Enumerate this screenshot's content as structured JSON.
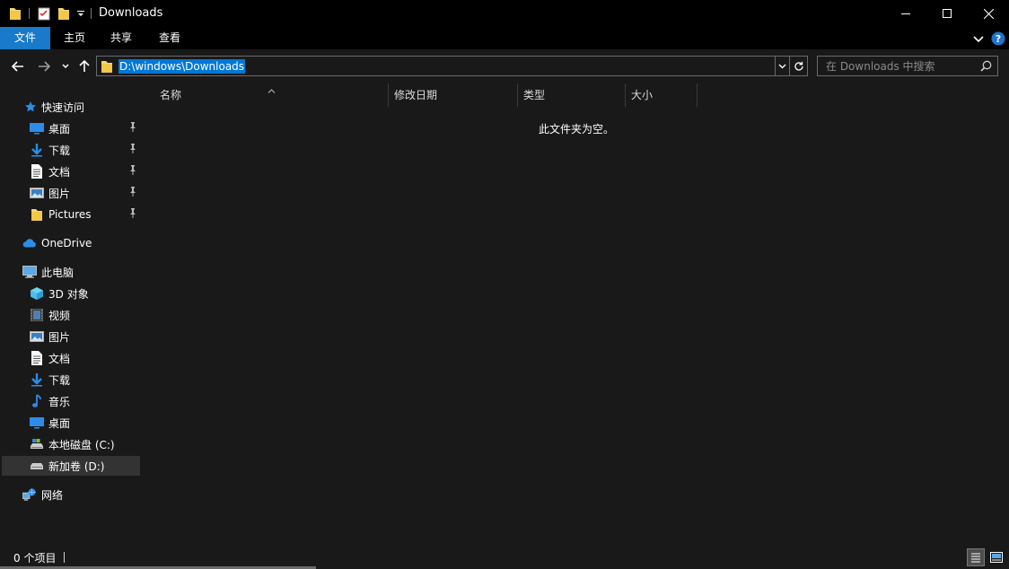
{
  "window": {
    "title": "Downloads",
    "minimize_glyph": "—",
    "maximize_glyph": "☐",
    "close_glyph": "✕"
  },
  "ribbon": {
    "tabs": [
      {
        "label": "文件",
        "active": true
      },
      {
        "label": "主页",
        "active": false
      },
      {
        "label": "共享",
        "active": false
      },
      {
        "label": "查看",
        "active": false
      }
    ]
  },
  "address": {
    "path": "D:\\windows\\Downloads"
  },
  "search": {
    "placeholder": "在 Downloads 中搜索"
  },
  "sidebar": {
    "quick_access": {
      "label": "快速访问",
      "items": [
        {
          "label": "桌面",
          "icon": "desktop-icon",
          "pinned": true
        },
        {
          "label": "下载",
          "icon": "download-icon",
          "pinned": true
        },
        {
          "label": "文档",
          "icon": "document-icon",
          "pinned": true
        },
        {
          "label": "图片",
          "icon": "pictures-icon",
          "pinned": true
        },
        {
          "label": "Pictures",
          "icon": "folder-icon",
          "pinned": true
        }
      ]
    },
    "onedrive": {
      "label": "OneDrive",
      "icon": "cloud-icon"
    },
    "this_pc": {
      "label": "此电脑",
      "items": [
        {
          "label": "3D 对象",
          "icon": "cube-icon"
        },
        {
          "label": "视频",
          "icon": "video-icon"
        },
        {
          "label": "图片",
          "icon": "pictures-icon"
        },
        {
          "label": "文档",
          "icon": "document-icon"
        },
        {
          "label": "下载",
          "icon": "download-icon"
        },
        {
          "label": "音乐",
          "icon": "music-icon"
        },
        {
          "label": "桌面",
          "icon": "desktop-icon"
        },
        {
          "label": "本地磁盘 (C:)",
          "icon": "drive-icon"
        },
        {
          "label": "新加卷 (D:)",
          "icon": "drive-icon",
          "selected": true
        }
      ]
    },
    "network": {
      "label": "网络",
      "icon": "network-icon"
    }
  },
  "columns": [
    {
      "label": "名称"
    },
    {
      "label": "修改日期"
    },
    {
      "label": "类型"
    },
    {
      "label": "大小"
    }
  ],
  "content": {
    "empty_message": "此文件夹为空。"
  },
  "status": {
    "item_count": "0 个项目"
  },
  "colors": {
    "accent": "#1979ca",
    "selection": "#0078d7",
    "background": "#191919",
    "titlebar": "#000000",
    "folder": "#f7d674"
  }
}
